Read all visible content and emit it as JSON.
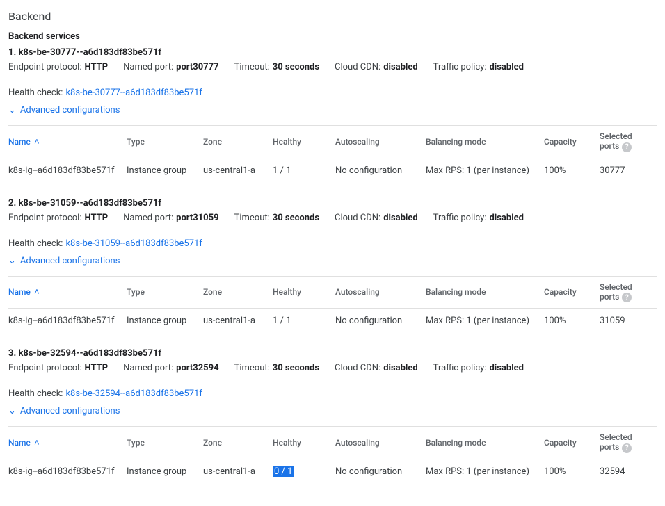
{
  "page": {
    "title": "Backend",
    "subsection": "Backend services"
  },
  "labels": {
    "endpointProtocol": "Endpoint protocol:",
    "namedPort": "Named port:",
    "timeout": "Timeout:",
    "cloudCdn": "Cloud CDN:",
    "trafficPolicy": "Traffic policy:",
    "healthCheck": "Health check:",
    "advanced": "Advanced configurations"
  },
  "columns": {
    "name": "Name",
    "type": "Type",
    "zone": "Zone",
    "healthy": "Healthy",
    "autoscaling": "Autoscaling",
    "balancing": "Balancing mode",
    "capacity": "Capacity",
    "ports": "Selected ports"
  },
  "services": [
    {
      "heading": "1. k8s-be-30777--a6d183df83be571f",
      "protocol": "HTTP",
      "port": "port30777",
      "timeout": "30 seconds",
      "cdn": "disabled",
      "trafficPolicy": "disabled",
      "healthCheckLink": "k8s-be-30777--a6d183df83be571f",
      "row": {
        "name": "k8s-ig--a6d183df83be571f",
        "type": "Instance group",
        "zone": "us-central1-a",
        "healthy": "1 / 1",
        "healthyHighlight": false,
        "autoscaling": "No configuration",
        "balancing": "Max RPS: 1 (per instance)",
        "capacity": "100%",
        "ports": "30777"
      }
    },
    {
      "heading": "2. k8s-be-31059--a6d183df83be571f",
      "protocol": "HTTP",
      "port": "port31059",
      "timeout": "30 seconds",
      "cdn": "disabled",
      "trafficPolicy": "disabled",
      "healthCheckLink": "k8s-be-31059--a6d183df83be571f",
      "row": {
        "name": "k8s-ig--a6d183df83be571f",
        "type": "Instance group",
        "zone": "us-central1-a",
        "healthy": "1 / 1",
        "healthyHighlight": false,
        "autoscaling": "No configuration",
        "balancing": "Max RPS: 1 (per instance)",
        "capacity": "100%",
        "ports": "31059"
      }
    },
    {
      "heading": "3. k8s-be-32594--a6d183df83be571f",
      "protocol": "HTTP",
      "port": "port32594",
      "timeout": "30 seconds",
      "cdn": "disabled",
      "trafficPolicy": "disabled",
      "healthCheckLink": "k8s-be-32594--a6d183df83be571f",
      "row": {
        "name": "k8s-ig--a6d183df83be571f",
        "type": "Instance group",
        "zone": "us-central1-a",
        "healthy": "0 / 1",
        "healthyHighlight": true,
        "autoscaling": "No configuration",
        "balancing": "Max RPS: 1 (per instance)",
        "capacity": "100%",
        "ports": "32594"
      }
    }
  ]
}
